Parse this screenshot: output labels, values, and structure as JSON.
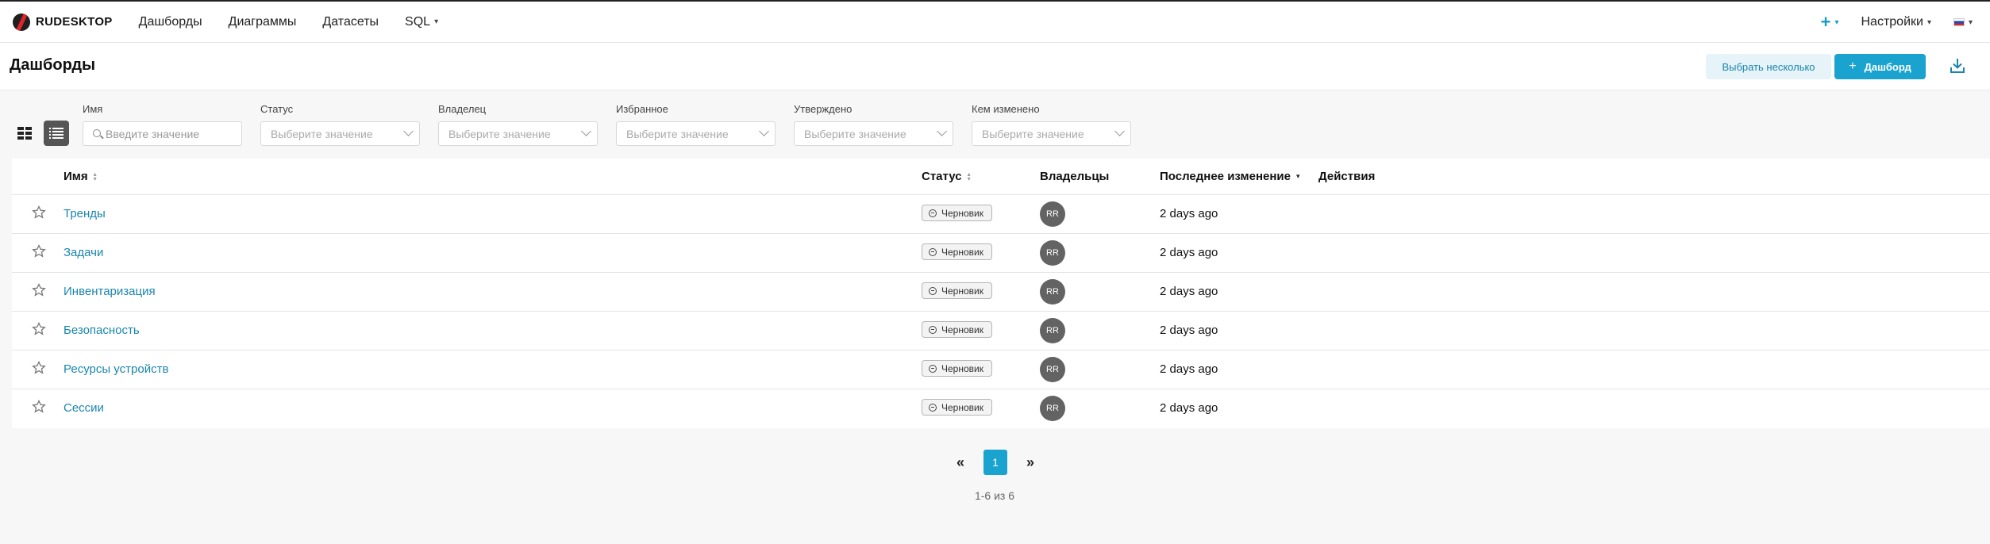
{
  "brand": {
    "name": "RUDESKTOP"
  },
  "nav": {
    "items": [
      {
        "label": "Дашборды"
      },
      {
        "label": "Диаграммы"
      },
      {
        "label": "Датасеты"
      },
      {
        "label": "SQL"
      }
    ],
    "plus_label": "+",
    "settings_label": "Настройки",
    "language": "ru"
  },
  "header": {
    "title": "Дашборды",
    "select_multiple_label": "Выбрать несколько",
    "new_dashboard_label": "Дашборд",
    "new_dashboard_icon": "+"
  },
  "filters": {
    "name": {
      "label": "Имя",
      "placeholder": "Введите значение"
    },
    "status": {
      "label": "Статус",
      "placeholder": "Выберите значение"
    },
    "owner": {
      "label": "Владелец",
      "placeholder": "Выберите значение"
    },
    "favorite": {
      "label": "Избранное",
      "placeholder": "Выберите значение"
    },
    "certified": {
      "label": "Утверждено",
      "placeholder": "Выберите значение"
    },
    "modified_by": {
      "label": "Кем изменено",
      "placeholder": "Выберите значение"
    }
  },
  "table": {
    "columns": {
      "name": "Имя",
      "status": "Статус",
      "owners": "Владельцы",
      "last_modified": "Последнее изменение",
      "actions": "Действия"
    },
    "rows": [
      {
        "name": "Тренды",
        "status": "Черновик",
        "owner_initials": "RR",
        "modified": "2 days ago"
      },
      {
        "name": "Задачи",
        "status": "Черновик",
        "owner_initials": "RR",
        "modified": "2 days ago"
      },
      {
        "name": "Инвентаризация",
        "status": "Черновик",
        "owner_initials": "RR",
        "modified": "2 days ago"
      },
      {
        "name": "Безопасность",
        "status": "Черновик",
        "owner_initials": "RR",
        "modified": "2 days ago"
      },
      {
        "name": "Ресурсы устройств",
        "status": "Черновик",
        "owner_initials": "RR",
        "modified": "2 days ago"
      },
      {
        "name": "Сессии",
        "status": "Черновик",
        "owner_initials": "RR",
        "modified": "2 days ago"
      }
    ]
  },
  "pagination": {
    "prev": "«",
    "current": "1",
    "next": "»",
    "summary": "1-6 из 6"
  },
  "colors": {
    "accent": "#1aa3cf",
    "link": "#1a86ad",
    "avatar": "#636363"
  }
}
